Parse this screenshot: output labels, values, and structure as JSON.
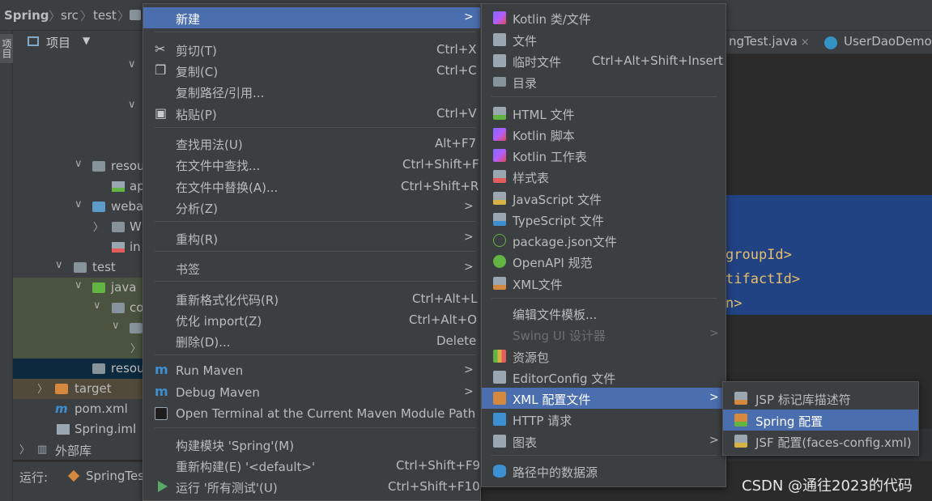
{
  "breadcrumb": {
    "project": "Spring",
    "items": [
      "src",
      "test"
    ]
  },
  "left_strip": {
    "label": "项目"
  },
  "project_panel": {
    "title": "项目",
    "tree": [
      {
        "label": "resou"
      },
      {
        "label": "ap"
      },
      {
        "label": "weba"
      },
      {
        "label": "W"
      },
      {
        "label": "in"
      },
      {
        "label": "test"
      },
      {
        "label": "java"
      },
      {
        "label": "co"
      },
      {
        "label": "resou"
      },
      {
        "label": "target"
      },
      {
        "label": "pom.xml"
      },
      {
        "label": "Spring.iml"
      },
      {
        "label": "外部库"
      }
    ]
  },
  "run_panel": {
    "label": "运行:",
    "config": "SpringTes"
  },
  "editor": {
    "tabs": [
      {
        "label": "ngTest.java"
      },
      {
        "label": "UserDaoDemo."
      }
    ],
    "code_lines": [
      "groupId>",
      "tifactId>",
      "n>"
    ]
  },
  "watermark": "CSDN @通往2023的代码",
  "context_menu": {
    "items": [
      {
        "label": "新建",
        "submenu": ">"
      },
      {
        "label": "剪切(T)",
        "shortcut": "Ctrl+X",
        "icon": "scissors-icon"
      },
      {
        "label": "复制(C)",
        "shortcut": "Ctrl+C",
        "icon": "copy-icon"
      },
      {
        "label": "复制路径/引用..."
      },
      {
        "label": "粘贴(P)",
        "shortcut": "Ctrl+V",
        "icon": "paste-icon"
      },
      {
        "label": "查找用法(U)",
        "shortcut": "Alt+F7"
      },
      {
        "label": "在文件中查找...",
        "shortcut": "Ctrl+Shift+F"
      },
      {
        "label": "在文件中替换(A)...",
        "shortcut": "Ctrl+Shift+R"
      },
      {
        "label": "分析(Z)",
        "submenu": ">"
      },
      {
        "label": "重构(R)",
        "submenu": ">"
      },
      {
        "label": "书签",
        "submenu": ">"
      },
      {
        "label": "重新格式化代码(R)",
        "shortcut": "Ctrl+Alt+L"
      },
      {
        "label": "优化 import(Z)",
        "shortcut": "Ctrl+Alt+O"
      },
      {
        "label": "删除(D)...",
        "shortcut": "Delete"
      },
      {
        "label": "Run Maven",
        "submenu": ">",
        "icon": "maven-icon"
      },
      {
        "label": "Debug Maven",
        "submenu": ">",
        "icon": "maven-icon"
      },
      {
        "label": "Open Terminal at the Current Maven Module Path",
        "icon": "terminal-icon"
      },
      {
        "label": "构建模块 'Spring'(M)"
      },
      {
        "label": "重新构建(E) '<default>'",
        "shortcut": "Ctrl+Shift+F9"
      },
      {
        "label": "运行 '所有测试'(U)",
        "shortcut": "Ctrl+Shift+F10",
        "icon": "run-icon"
      }
    ]
  },
  "new_submenu": {
    "items": [
      {
        "label": "Kotlin 类/文件",
        "icon": "kotlin-class-icon"
      },
      {
        "label": "文件",
        "icon": "file-icon"
      },
      {
        "label": "临时文件",
        "shortcut": "Ctrl+Alt+Shift+Insert",
        "icon": "scratch-file-icon"
      },
      {
        "label": "目录",
        "icon": "folder-icon"
      },
      {
        "label": "HTML 文件",
        "icon": "html-file-icon"
      },
      {
        "label": "Kotlin 脚本",
        "icon": "kotlin-script-icon"
      },
      {
        "label": "Kotlin 工作表",
        "icon": "kotlin-worksheet-icon"
      },
      {
        "label": "样式表",
        "icon": "css-file-icon"
      },
      {
        "label": "JavaScript 文件",
        "icon": "js-file-icon"
      },
      {
        "label": "TypeScript 文件",
        "icon": "ts-file-icon"
      },
      {
        "label": "package.json文件",
        "icon": "json-icon"
      },
      {
        "label": "OpenAPI 规范",
        "icon": "openapi-icon"
      },
      {
        "label": "XML文件",
        "icon": "xml-file-icon"
      },
      {
        "label": "编辑文件模板..."
      },
      {
        "label": "Swing UI 设计器",
        "submenu": ">",
        "disabled": true
      },
      {
        "label": "资源包",
        "icon": "resource-bundle-icon"
      },
      {
        "label": "EditorConfig 文件",
        "icon": "editorconfig-icon"
      },
      {
        "label": "XML 配置文件",
        "submenu": ">",
        "icon": "xml-config-icon"
      },
      {
        "label": "HTTP 请求",
        "icon": "api-icon"
      },
      {
        "label": "图表",
        "submenu": ">",
        "icon": "diagram-icon"
      },
      {
        "label": "路径中的数据源",
        "icon": "database-icon"
      }
    ]
  },
  "xml_config_submenu": {
    "items": [
      {
        "label": "JSP 标记库描述符",
        "icon": "jsp-tld-icon"
      },
      {
        "label": "Spring 配置",
        "icon": "spring-config-icon"
      },
      {
        "label": "JSF 配置(faces-config.xml)",
        "icon": "jsf-config-icon"
      }
    ]
  }
}
